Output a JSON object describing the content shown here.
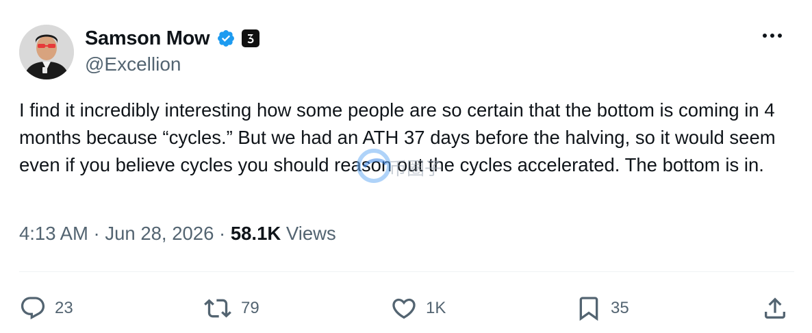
{
  "author": {
    "name": "Samson Mow",
    "handle": "@Excellion",
    "verified_icon": "verified-badge-icon",
    "affiliation_icon": "affiliation-badge-icon"
  },
  "tweet": {
    "text": "I find it incredibly interesting how some people are so certain that the bottom is coming in 4 months because “cycles.” But we had an ATH 37 days before the halving, so it would seem even if you believe cycles you should reason out the cycles accelerated. The bottom is in."
  },
  "meta": {
    "time": "4:13 AM",
    "separator": " · ",
    "date": "Jun 28, 2026",
    "views_count": "58.1K",
    "views_label": " Views"
  },
  "actions": {
    "replies": "23",
    "reposts": "79",
    "likes": "1K",
    "bookmarks": "35"
  },
  "watermark": {
    "text": "币圈子"
  },
  "colors": {
    "text": "#0f1419",
    "secondary": "#536471",
    "verified": "#1d9bf0",
    "divider": "#eff3f4"
  }
}
